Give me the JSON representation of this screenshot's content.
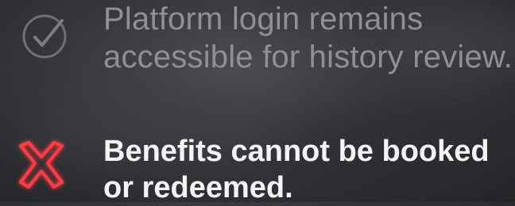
{
  "items": [
    {
      "status": "allowed",
      "icon": "check-circle-icon",
      "lines": [
        "Platform login remains",
        "accessible for history review."
      ],
      "color": "#8e9094"
    },
    {
      "status": "denied",
      "icon": "cross-icon",
      "lines": [
        "Benefits cannot be booked",
        "or redeemed."
      ],
      "color": "#f4f4f4",
      "icon_color": "#ff3b45"
    }
  ]
}
